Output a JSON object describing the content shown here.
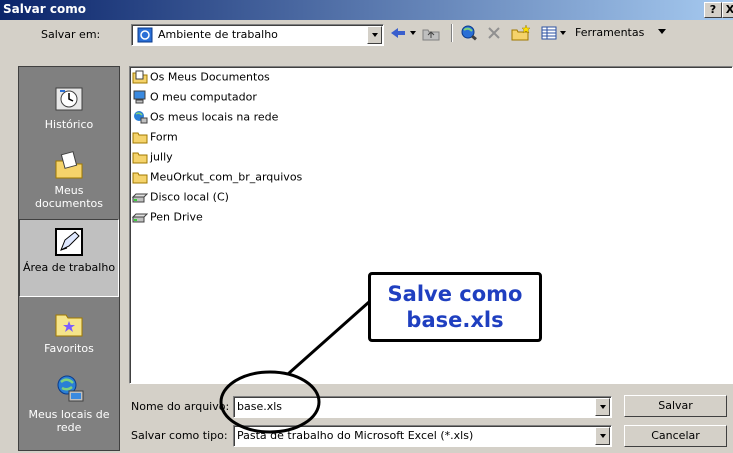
{
  "window": {
    "title": "Salvar como",
    "help_button": "?",
    "close_button": "X"
  },
  "toolbar": {
    "save_in_label": "Salvar em:",
    "location": "Ambiente de trabalho",
    "tools_label": "Ferramentas"
  },
  "places": [
    {
      "label": "Histórico",
      "icon": "history-icon"
    },
    {
      "label": "Meus documentos",
      "icon": "my-documents-icon"
    },
    {
      "label": "Área de trabalho",
      "icon": "desktop-icon",
      "active": true
    },
    {
      "label": "Favoritos",
      "icon": "favorites-icon"
    },
    {
      "label": "Meus locais de rede",
      "icon": "network-places-icon"
    }
  ],
  "files": [
    {
      "name": "Os Meus Documentos",
      "icon": "documents-folder-icon"
    },
    {
      "name": "O meu computador",
      "icon": "computer-icon"
    },
    {
      "name": "Os meus locais na rede",
      "icon": "network-icon"
    },
    {
      "name": "Form",
      "icon": "folder-icon"
    },
    {
      "name": "jully",
      "icon": "folder-icon"
    },
    {
      "name": "MeuOrkut_com_br_arquivos",
      "icon": "folder-icon"
    },
    {
      "name": "Disco local (C)",
      "icon": "drive-icon"
    },
    {
      "name": "Pen Drive",
      "icon": "drive-icon"
    }
  ],
  "form": {
    "filename_label": "Nome do arquivo:",
    "filename_value": "base.xls",
    "filetype_label": "Salvar como tipo:",
    "filetype_value": "Pasta de trabalho do Microsoft Excel (*.xls)",
    "save_button": "Salvar",
    "cancel_button": "Cancelar"
  },
  "annotation": {
    "line1": "Salve como",
    "line2": "base.xls"
  },
  "colors": {
    "title_gradient_start": "#0a246a",
    "title_gradient_end": "#a6caf0",
    "callout_text": "#1f3fc0",
    "face": "#d4d0c8"
  }
}
